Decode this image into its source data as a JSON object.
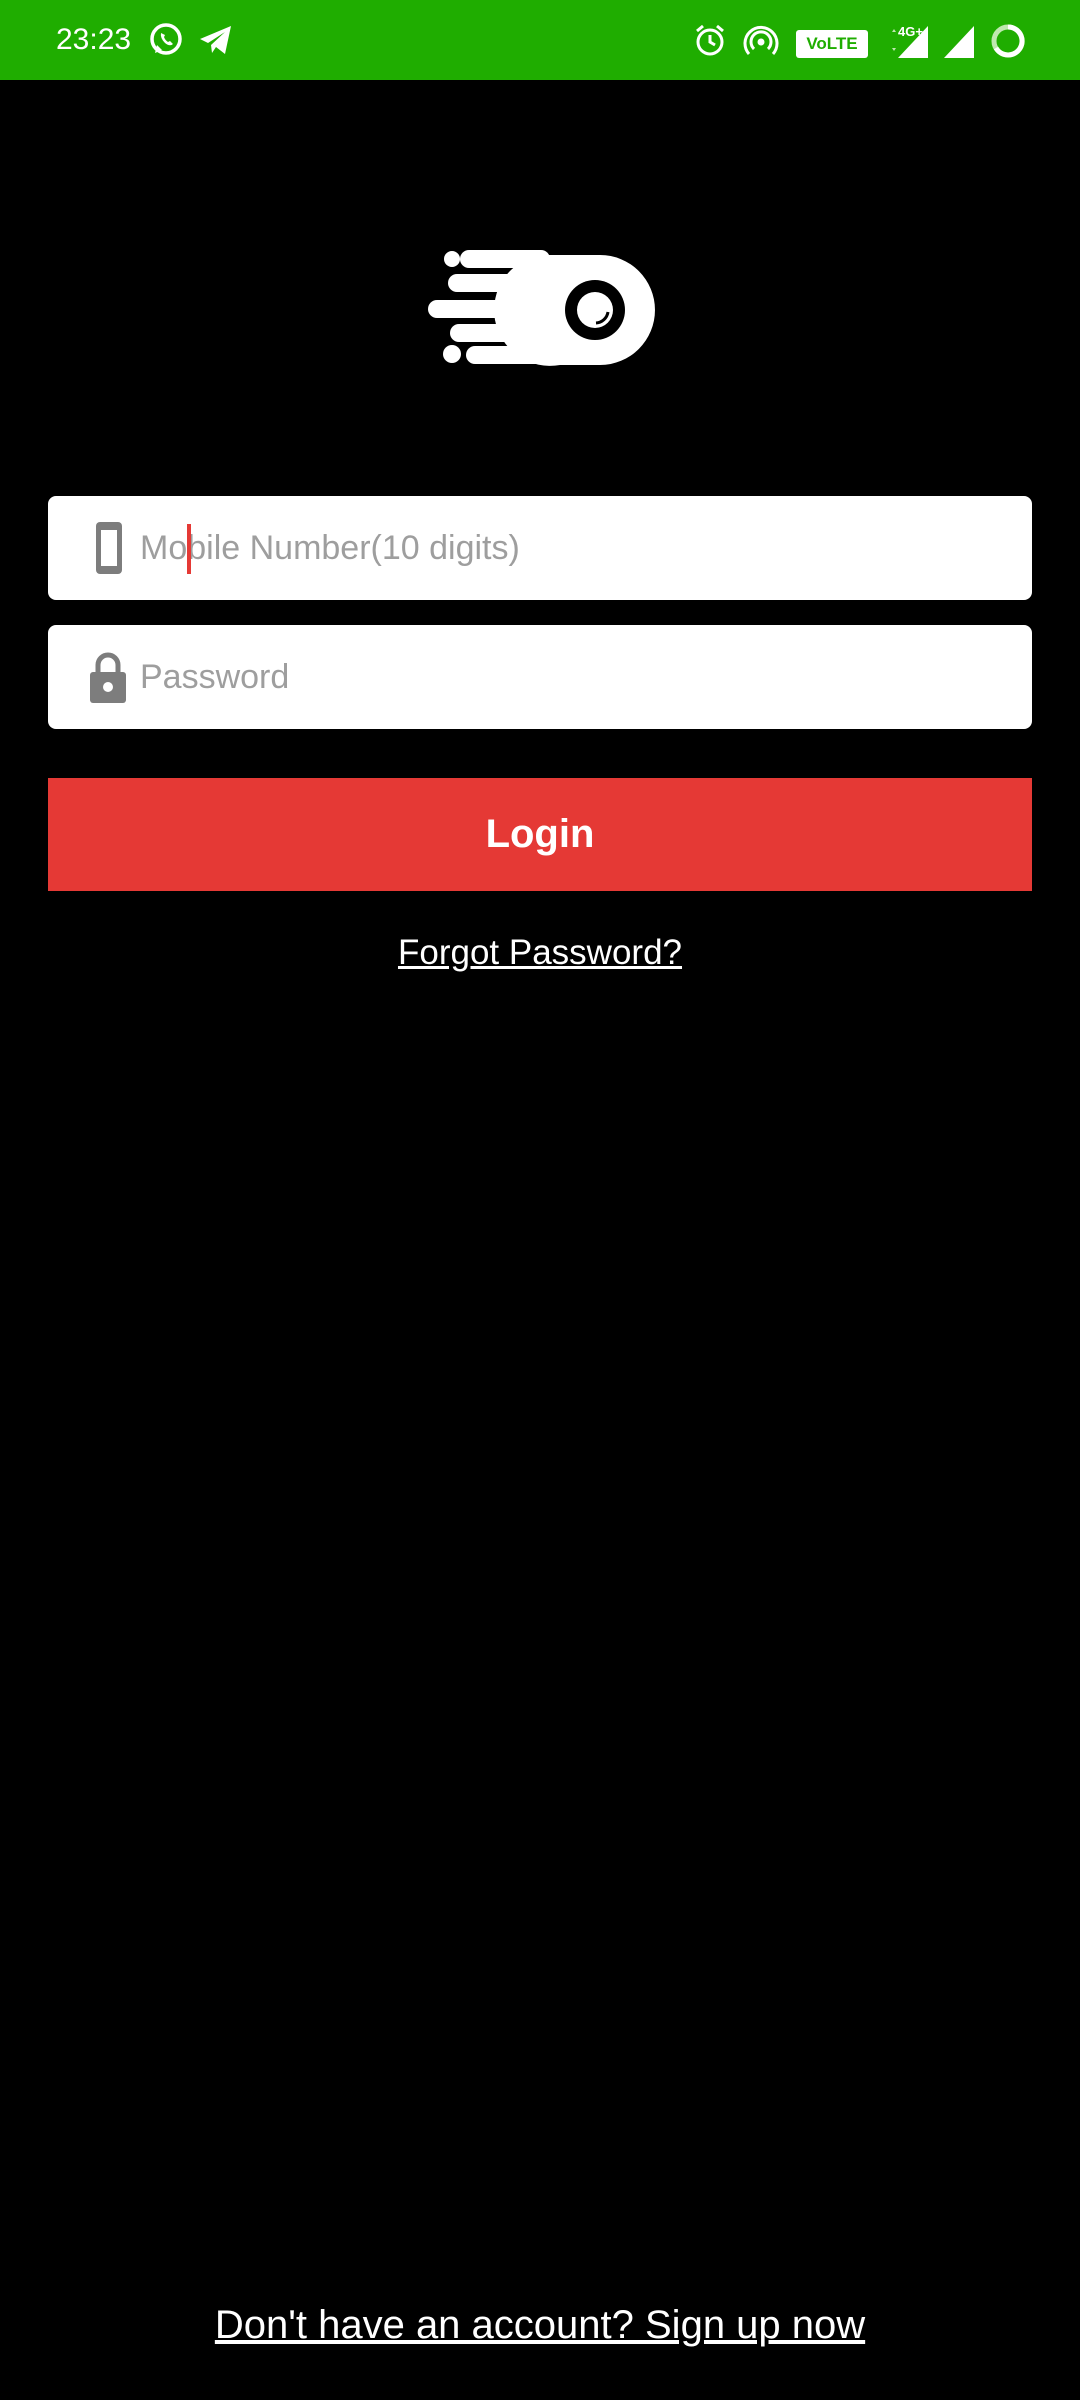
{
  "status_bar": {
    "time": "23:23",
    "volte": "VoLTE",
    "network_type": "4G+",
    "background_color": "#1fad00",
    "icons": [
      "whatsapp-icon",
      "telegram-icon",
      "alarm-icon",
      "hotspot-icon",
      "volte-badge",
      "signal-icon",
      "signal-icon",
      "battery-icon"
    ]
  },
  "logo": {
    "icon": "speed-ball-logo-icon"
  },
  "login_form": {
    "phone": {
      "placeholder": "Mobile Number(10 digits)",
      "value": "",
      "icon": "mobile-phone-icon"
    },
    "password": {
      "placeholder": "Password",
      "value": "",
      "icon": "lock-icon"
    },
    "login_label": "Login",
    "forgot_label": "Forgot Password?"
  },
  "footer": {
    "signup_label": "Don't have an account? Sign up now"
  },
  "colors": {
    "accent": "#e53935",
    "background": "#000000",
    "status_bar": "#1fad00"
  }
}
